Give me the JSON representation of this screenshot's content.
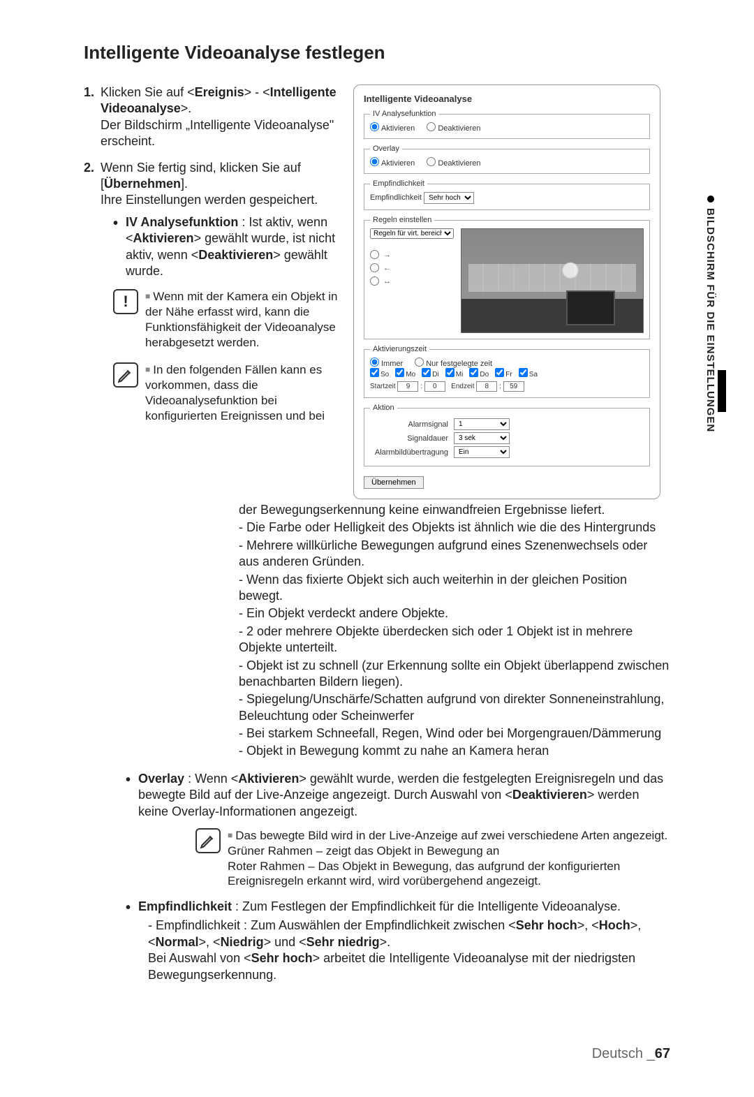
{
  "section_tab": "BILDSCHIRM FÜR DIE EINSTELLUNGEN",
  "title": "Intelligente Videoanalyse festlegen",
  "steps": {
    "s1": {
      "num": "1.",
      "line1_pre": "Klicken Sie auf <",
      "line1_b1": "Ereignis",
      "line1_mid": "> - <",
      "line1_b2": "Intelligente Videoanalyse",
      "line1_post": ">.",
      "line2": "Der Bildschirm „Intelligente Videoanalyse\" erscheint."
    },
    "s2": {
      "num": "2.",
      "line1_pre": "Wenn Sie fertig sind, klicken Sie auf [",
      "line1_b": "Übernehmen",
      "line1_post": "].",
      "line2": "Ihre Einstellungen werden gespeichert."
    }
  },
  "iv_bullet": {
    "label": "IV Analysefunktion",
    "t1": " : Ist aktiv, wenn <",
    "b1": "Aktivieren",
    "t2": "> gewählt wurde, ist nicht aktiv, wenn <",
    "b2": "Deaktivieren",
    "t3": "> gewählt wurde."
  },
  "warn1": "Wenn mit der Kamera ein Objekt in der Nähe erfasst wird, kann die Funktionsfähigkeit der Videoanalyse herabgesetzt werden.",
  "note2_intro": "In den folgenden Fällen kann es vorkommen, dass die Videoanalysefunktion bei konfigurierten Ereignissen und bei",
  "note2_cont": "der Bewegungserkennung keine einwandfreien Ergebnisse liefert.",
  "note2_items": [
    "- Die Farbe oder Helligkeit des Objekts ist ähnlich wie die des Hintergrunds",
    "- Mehrere willkürliche Bewegungen aufgrund eines Szenenwechsels oder aus anderen Gründen.",
    "- Wenn das fixierte Objekt sich auch weiterhin in der gleichen Position bewegt.",
    "- Ein Objekt verdeckt andere Objekte.",
    "- 2 oder mehrere Objekte überdecken sich oder 1 Objekt ist in mehrere Objekte unterteilt.",
    "- Objekt ist zu schnell (zur Erkennung sollte ein Objekt überlappend zwischen benachbarten Bildern liegen).",
    "- Spiegelung/Unschärfe/Schatten aufgrund von direkter Sonneneinstrahlung, Beleuchtung oder Scheinwerfer",
    "- Bei starkem Schneefall, Regen, Wind oder bei Morgengrauen/Dämmerung",
    "- Objekt in Bewegung kommt zu nahe an Kamera heran"
  ],
  "overlay_bullet": {
    "label": "Overlay",
    "t1": " : Wenn <",
    "b1": "Aktivieren",
    "t2": "> gewählt wurde, werden die festgelegten Ereignisregeln und das bewegte Bild auf der Live-Anzeige angezeigt. Durch Auswahl von <",
    "b2": "Deaktivieren",
    "t3": "> werden keine Overlay-Informationen angezeigt."
  },
  "note3": {
    "l1": "Das bewegte Bild wird in der Live-Anzeige auf zwei verschiedene Arten angezeigt.",
    "l2": "Grüner Rahmen – zeigt das Objekt in Bewegung an",
    "l3": "Roter Rahmen – Das Objekt in Bewegung, das aufgrund der konfigurierten Ereignisregeln erkannt wird, wird vorübergehend angezeigt."
  },
  "emp_bullet": {
    "label": "Empfindlichkeit",
    "t1": " : Zum Festlegen der Empfindlichkeit für die Intelligente Videoanalyse.",
    "sub_pre": "- Empfindlichkeit : Zum Auswählen der Empfindlichkeit zwischen <",
    "o1": "Sehr hoch",
    "c1": ">, <",
    "o2": "Hoch",
    "c2": ">, <",
    "o3": "Normal",
    "c3": ">, <",
    "o4": "Niedrig",
    "c4": "> und <",
    "o5": "Sehr niedrig",
    "c5": ">.",
    "sub2_pre": "Bei Auswahl von <",
    "sub2_b": "Sehr hoch",
    "sub2_post": "> arbeitet die Intelligente Videoanalyse mit der niedrigsten Bewegungserkennung."
  },
  "panel": {
    "title": "Intelligente Videoanalyse",
    "grp_iv": "IV Analysefunktion",
    "grp_overlay": "Overlay",
    "grp_emp": "Empfindlichkeit",
    "emp_label": "Empfindlichkeit",
    "emp_value": "Sehr hoch",
    "grp_rules": "Regeln einstellen",
    "rules_select": "Regeln für virt. bereich",
    "grp_time": "Aktivierungszeit",
    "opt_activate": "Aktivieren",
    "opt_deactivate": "Deaktivieren",
    "opt_always": "Immer",
    "opt_fixed": "Nur festgelegte zeit",
    "days": [
      "So",
      "Mo",
      "Di",
      "Mi",
      "Do",
      "Fr",
      "Sa"
    ],
    "start_label": "Startzeit",
    "end_label": "Endzeit",
    "time_start_h": "9",
    "time_start_m": "0",
    "time_end_h": "8",
    "time_end_m": "59",
    "grp_action": "Aktion",
    "a_alarm": "Alarmsignal",
    "a_alarm_v": "1",
    "a_dur": "Signaldauer",
    "a_dur_v": "3 sek",
    "a_img": "Alarmbildübertragung",
    "a_img_v": "Ein",
    "apply": "Übernehmen"
  },
  "footer": {
    "lang": "Deutsch _",
    "page": "67"
  }
}
